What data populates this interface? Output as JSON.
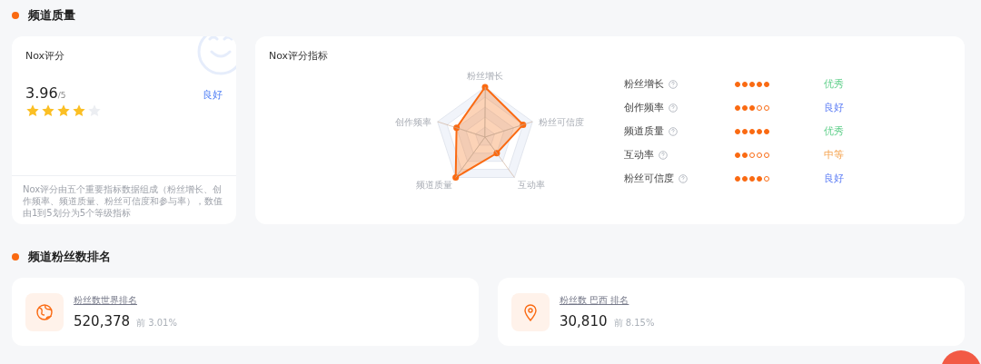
{
  "sections": [
    {
      "title": "频道质量"
    },
    {
      "title": "频道粉丝数排名"
    }
  ],
  "nox_score": {
    "title": "Nox评分",
    "score": "3.96",
    "max": "/5",
    "grade": "良好",
    "stars": 4,
    "description": "Nox评分由五个重要指标数据组成（粉丝增长、创作频率、频道质量、粉丝可信度和参与率），数值由1到5划分为5个等级指标"
  },
  "indicators": {
    "title": "Nox评分指标",
    "radar_axes": [
      {
        "label": "粉丝增长",
        "level": 1
      },
      {
        "label": "粉丝可信度",
        "level": 0.8
      },
      {
        "label": "互动率",
        "level": 0.4
      },
      {
        "label": "频道质量",
        "level": 1
      },
      {
        "label": "创作频率",
        "level": 0.6
      }
    ],
    "items": [
      {
        "name": "粉丝增长",
        "stars": 5,
        "rating": "优秀",
        "kind": "excellent"
      },
      {
        "name": "创作频率",
        "stars": 3,
        "rating": "良好",
        "kind": "good"
      },
      {
        "name": "频道质量",
        "stars": 5,
        "rating": "优秀",
        "kind": "excellent"
      },
      {
        "name": "互动率",
        "stars": 2,
        "rating": "中等",
        "kind": "medium"
      },
      {
        "name": "粉丝可信度",
        "stars": 4,
        "rating": "良好",
        "kind": "good"
      }
    ]
  },
  "rankings": [
    {
      "kind": "globe",
      "label": "粉丝数世界排名",
      "value": "520,378",
      "percent": "前 3.01%"
    },
    {
      "kind": "pin",
      "label": "粉丝数 巴西 排名",
      "value": "30,810",
      "percent": "前 8.15%"
    }
  ]
}
